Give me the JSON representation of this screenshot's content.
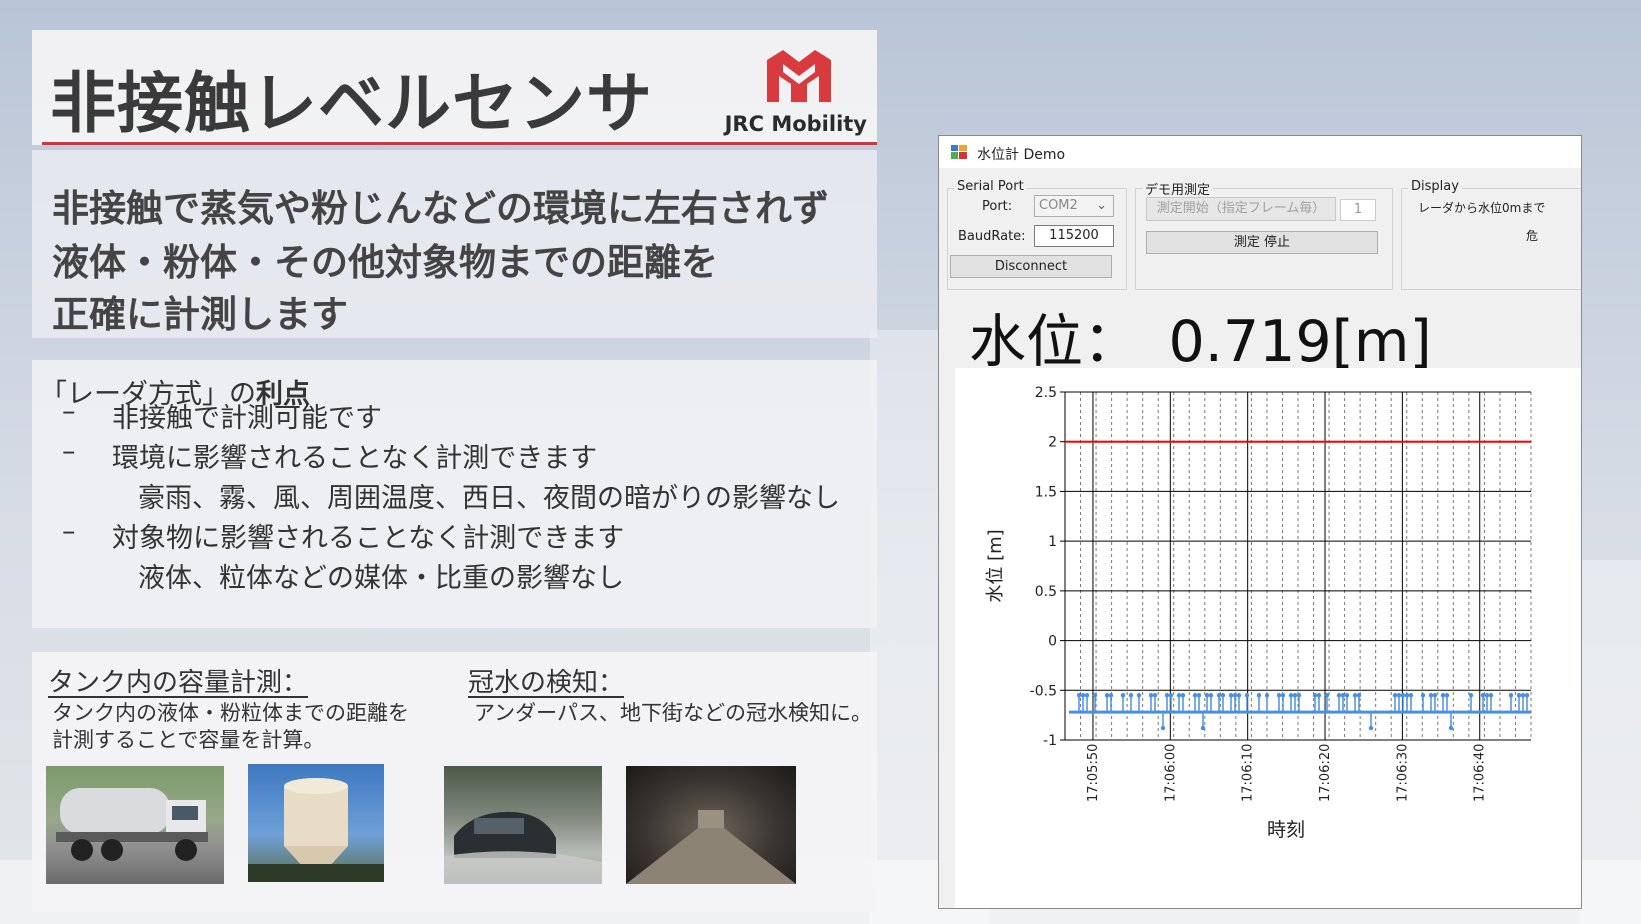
{
  "slide": {
    "title": "非接触レベルセンサ",
    "logo_text": "JRC Mobility",
    "lead": [
      "非接触で蒸気や粉じんなどの環境に左右されず",
      "液体・粉体・その他対象物までの距離を",
      "正確に計測します"
    ],
    "advantages": {
      "title_prefix": "「レーダ方式」の",
      "title_bold": "利点",
      "items": [
        {
          "dash": "–",
          "text": "非接触で計測可能です"
        },
        {
          "dash": "–",
          "text": "環境に影響されることなく計測できます"
        },
        {
          "dash": "",
          "text": "豪雨、霧、風、周囲温度、西日、夜間の暗がりの影響なし"
        },
        {
          "dash": "–",
          "text": "対象物に影響されることなく計測できます"
        },
        {
          "dash": "",
          "text": "液体、粒体などの媒体・比重の影響なし"
        }
      ]
    },
    "uses": [
      {
        "heading": "タンク内の容量計測：",
        "desc": [
          "タンク内の液体・粉粒体までの距離を",
          "計測することで容量を計算。"
        ]
      },
      {
        "heading": "冠水の検知：",
        "desc": [
          "アンダーパス、地下街などの冠水検知に。"
        ]
      }
    ]
  },
  "app": {
    "window_title": "水位計 Demo",
    "serial": {
      "group_label": "Serial Port",
      "port_label": "Port:",
      "port_value": "COM2",
      "baud_label": "BaudRate:",
      "baud_value": "115200",
      "disconnect_label": "Disconnect"
    },
    "demo": {
      "group_label": "デモ用測定",
      "start_label": "測定開始（指定フレーム毎）",
      "frame_value": "1",
      "stop_label": "測定 停止"
    },
    "display": {
      "group_label": "Display",
      "line1": "レーダから水位0mまで",
      "line2": "危"
    },
    "readout": "水位：　0.719[m]"
  },
  "chart_data": {
    "type": "line",
    "xlabel": "時刻",
    "ylabel": "水位 [m]",
    "ylim": [
      -1,
      2.5
    ],
    "yticks": [
      "2.5",
      "2",
      "1.5",
      "1",
      "0.5",
      "0",
      "-0.5",
      "-1"
    ],
    "xticks": [
      "17:05:50",
      "17:06:00",
      "17:06:10",
      "17:06:20",
      "17:06:30",
      "17:06:40"
    ],
    "grid": true,
    "series": [
      {
        "color": "#ff0000",
        "y": 2.0
      },
      {
        "color": "#4a90e2",
        "baseline": -0.72,
        "spike_high": -0.55,
        "spike_low": -0.88
      }
    ]
  }
}
